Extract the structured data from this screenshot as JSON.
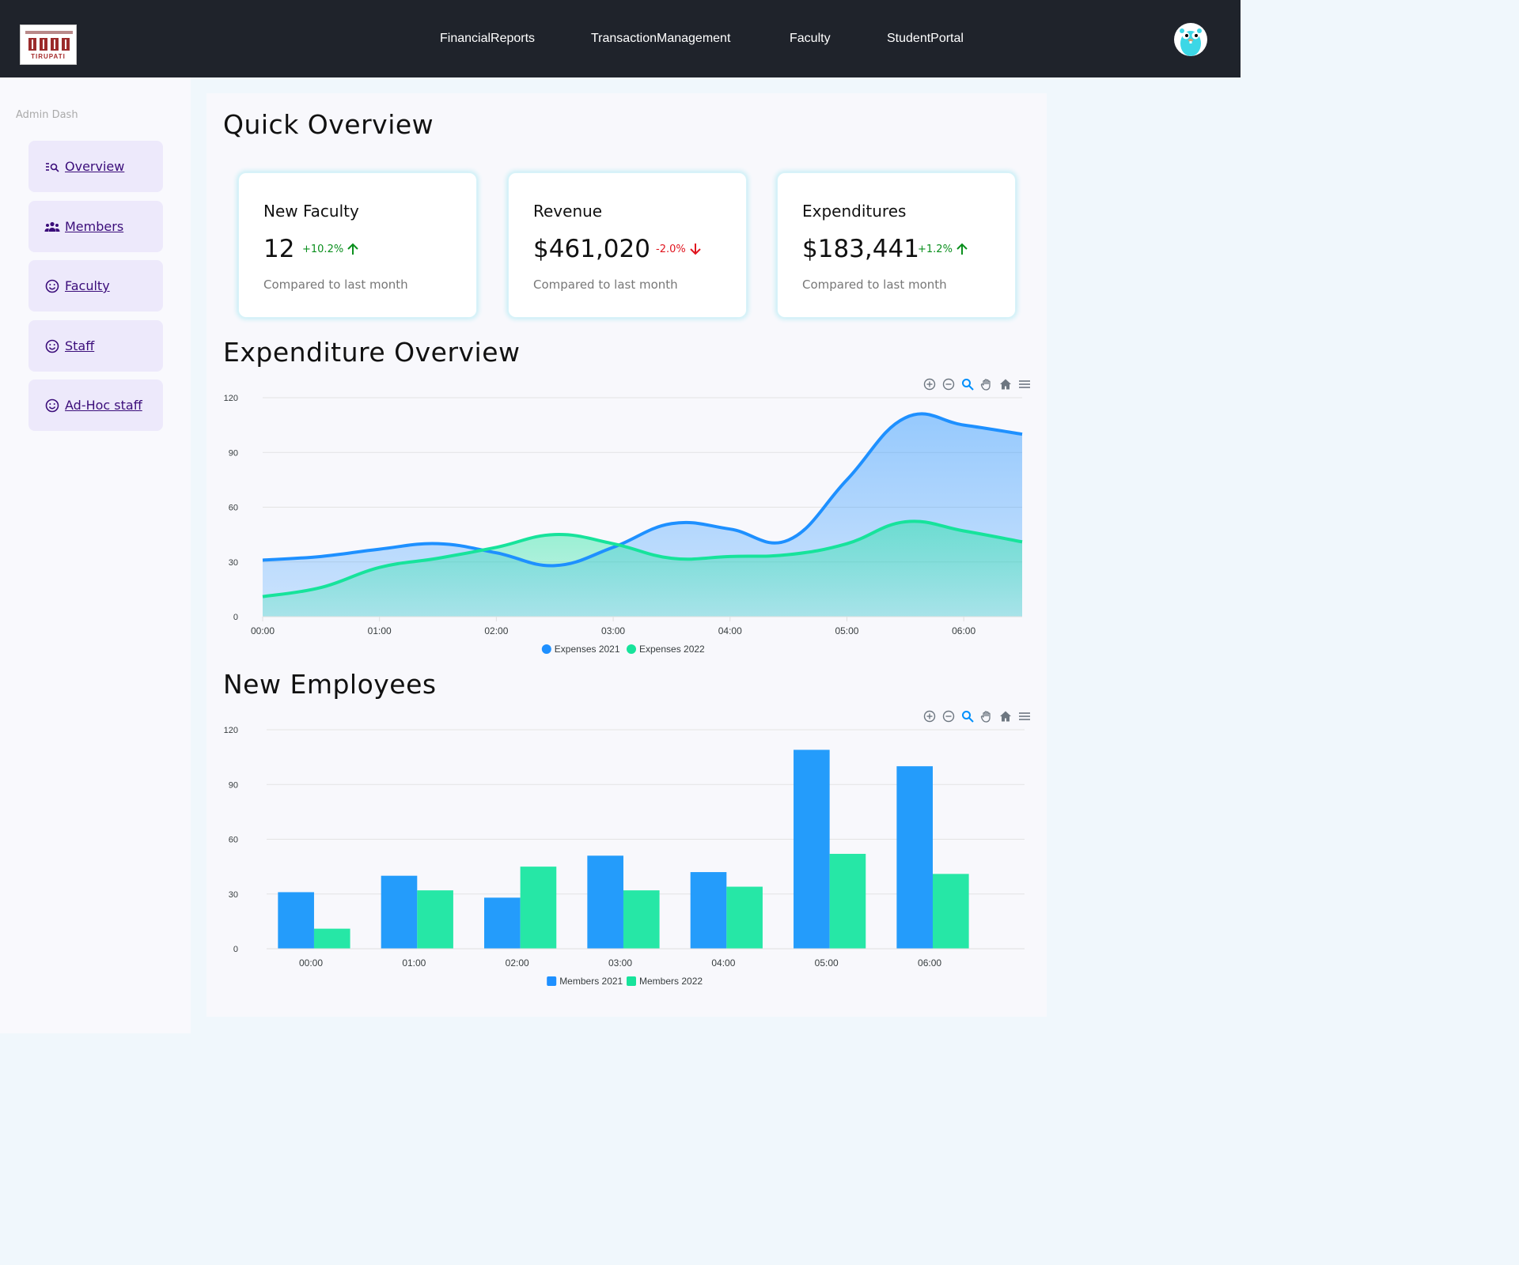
{
  "nav": {
    "logo_text": "TIRUPATI",
    "links": [
      "FinancialReports",
      "TransactionManagement",
      "Faculty",
      "StudentPortal"
    ]
  },
  "sidebar": {
    "title": "Admin Dash",
    "items": [
      {
        "label": "Overview",
        "icon": "search-list-icon"
      },
      {
        "label": "Members",
        "icon": "group-icon"
      },
      {
        "label": "Faculty",
        "icon": "smile-icon"
      },
      {
        "label": "Staff",
        "icon": "smile-icon"
      },
      {
        "label": "Ad-Hoc staff",
        "icon": "smile-icon"
      }
    ]
  },
  "overview": {
    "title": "Quick Overview",
    "cards": [
      {
        "title": "New Faculty",
        "value": "12",
        "delta": "+10.2%",
        "trend": "up",
        "sub": "Compared to last month"
      },
      {
        "title": "Revenue",
        "value": "$461,020",
        "delta": "-2.0%",
        "trend": "down",
        "sub": "Compared to last month"
      },
      {
        "title": "Expenditures",
        "value": "$183,441",
        "delta": "+1.2%",
        "trend": "up",
        "sub": "Compared to last month"
      }
    ]
  },
  "colors": {
    "series1": "#1e90ff",
    "series2": "#17e39b",
    "up": "#0a8f1d",
    "down": "#e0141e"
  },
  "chart_data": [
    {
      "title": "Expenditure Overview",
      "type": "area",
      "x": [
        "00:00",
        "00:30",
        "01:00",
        "01:30",
        "02:00",
        "02:30",
        "03:00",
        "03:30",
        "04:00",
        "04:30",
        "05:00",
        "05:30",
        "06:00",
        "06:30"
      ],
      "xticks": [
        "00:00",
        "01:00",
        "02:00",
        "03:00",
        "04:00",
        "05:00",
        "06:00"
      ],
      "series": [
        {
          "name": "Expenses 2021",
          "values": [
            31,
            33,
            37,
            40,
            35,
            28,
            38,
            51,
            48,
            42,
            75,
            109,
            105,
            100
          ]
        },
        {
          "name": "Expenses 2022",
          "values": [
            11,
            16,
            27,
            32,
            38,
            45,
            40,
            32,
            33,
            34,
            40,
            52,
            47,
            41
          ]
        }
      ],
      "ylim": [
        0,
        120
      ],
      "yticks": [
        0,
        30,
        60,
        90,
        120
      ],
      "legend": "bottom-center"
    },
    {
      "title": "New Employees",
      "type": "bar",
      "categories": [
        "00:00",
        "01:00",
        "02:00",
        "03:00",
        "04:00",
        "05:00",
        "06:00"
      ],
      "series": [
        {
          "name": "Members 2021",
          "values": [
            31,
            40,
            28,
            51,
            42,
            109,
            100
          ]
        },
        {
          "name": "Members 2022",
          "values": [
            11,
            32,
            45,
            32,
            34,
            52,
            41
          ]
        }
      ],
      "ylim": [
        0,
        120
      ],
      "yticks": [
        0,
        30,
        60,
        90,
        120
      ],
      "legend": "bottom-center"
    }
  ]
}
